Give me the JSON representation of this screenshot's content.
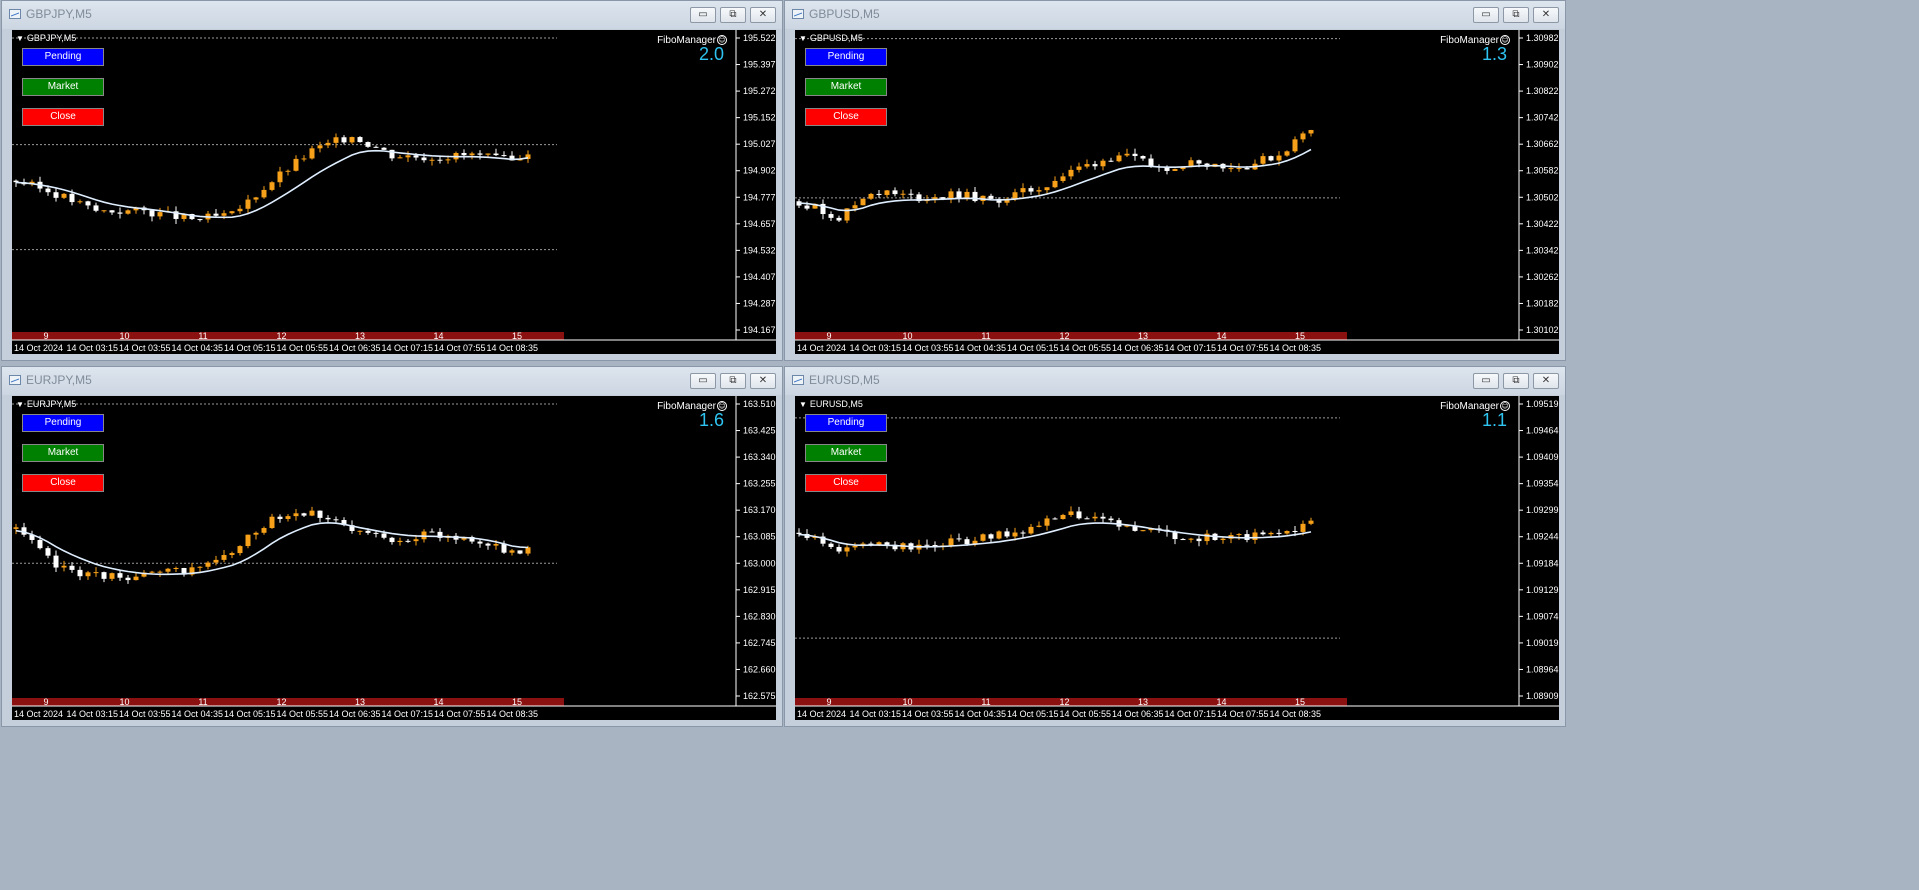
{
  "colors": {
    "bull": "#f7a11a",
    "bear": "#ffffff",
    "ma": "#dfeeff",
    "level": "#9a9a9a",
    "axis": "#ffffff",
    "day_bar": "#8b1010",
    "value": "#2ec3f0"
  },
  "icons": [
    "chart-window-icon",
    "minimize-icon",
    "maximize-icon",
    "close-icon",
    "smile-icon",
    "triangle-down-icon"
  ],
  "windows": [
    {
      "title": "GBPJPY,M5",
      "symbol": "GBPJPY,M5",
      "fibo": "FiboManager",
      "value": "2.0",
      "buttons": {
        "pending": "Pending",
        "market": "Market",
        "close": "Close"
      },
      "controls": {
        "min": "▭",
        "max": "⧉",
        "close": "✕"
      }
    },
    {
      "title": "GBPUSD,M5",
      "symbol": "GBPUSD,M5",
      "fibo": "FiboManager",
      "value": "1.3",
      "buttons": {
        "pending": "Pending",
        "market": "Market",
        "close": "Close"
      },
      "controls": {
        "min": "▭",
        "max": "⧉",
        "close": "✕"
      }
    },
    {
      "title": "EURJPY,M5",
      "symbol": "EURJPY,M5",
      "fibo": "FiboManager",
      "value": "1.6",
      "buttons": {
        "pending": "Pending",
        "market": "Market",
        "close": "Close"
      },
      "controls": {
        "min": "▭",
        "max": "⧉",
        "close": "✕"
      }
    },
    {
      "title": "EURUSD,M5",
      "symbol": "EURUSD,M5",
      "fibo": "FiboManager",
      "value": "1.1",
      "buttons": {
        "pending": "Pending",
        "market": "Market",
        "close": "Close"
      },
      "controls": {
        "min": "▭",
        "max": "⧉",
        "close": "✕"
      }
    }
  ],
  "chart_data": [
    {
      "type": "candlestick",
      "symbol": "GBPJPY,M5",
      "y_ticks": [
        "195.522",
        "195.397",
        "195.272",
        "195.152",
        "195.027",
        "194.902",
        "194.777",
        "194.657",
        "194.532",
        "194.407",
        "194.287",
        "194.167"
      ],
      "ylim": [
        194.167,
        195.522
      ],
      "x_labels": [
        "14 Oct 2024",
        "14 Oct 03:15",
        "14 Oct 03:55",
        "14 Oct 04:35",
        "14 Oct 05:15",
        "14 Oct 05:55",
        "14 Oct 06:35",
        "14 Oct 07:15",
        "14 Oct 07:55",
        "14 Oct 08:35"
      ],
      "day_labels": [
        "9",
        "10",
        "11",
        "12",
        "13",
        "14",
        "15"
      ],
      "levels": [
        195.522,
        195.027,
        194.54
      ],
      "anchors": [
        [
          0,
          194.86
        ],
        [
          5,
          194.8
        ],
        [
          10,
          194.72
        ],
        [
          16,
          194.72
        ],
        [
          22,
          194.68
        ],
        [
          27,
          194.7
        ],
        [
          32,
          194.86
        ],
        [
          37,
          195.0
        ],
        [
          42,
          195.07
        ],
        [
          47,
          194.98
        ],
        [
          52,
          194.97
        ],
        [
          57,
          194.98
        ],
        [
          62,
          194.95
        ],
        [
          64,
          195.0
        ]
      ]
    },
    {
      "type": "candlestick",
      "symbol": "GBPUSD,M5",
      "y_ticks": [
        "1.30982",
        "1.30902",
        "1.30822",
        "1.30742",
        "1.30662",
        "1.30582",
        "1.30502",
        "1.30422",
        "1.30342",
        "1.30262",
        "1.30182",
        "1.30102"
      ],
      "ylim": [
        1.30102,
        1.30982
      ],
      "x_labels": [
        "14 Oct 2024",
        "14 Oct 03:15",
        "14 Oct 03:55",
        "14 Oct 04:35",
        "14 Oct 05:15",
        "14 Oct 05:55",
        "14 Oct 06:35",
        "14 Oct 07:15",
        "14 Oct 07:55",
        "14 Oct 08:35"
      ],
      "day_labels": [
        "9",
        "10",
        "11",
        "12",
        "13",
        "14",
        "15"
      ],
      "levels": [
        1.3098,
        1.305
      ],
      "anchors": [
        [
          0,
          1.3049
        ],
        [
          5,
          1.3044
        ],
        [
          9,
          1.3052
        ],
        [
          15,
          1.305
        ],
        [
          20,
          1.3051
        ],
        [
          24,
          1.3049
        ],
        [
          30,
          1.3053
        ],
        [
          35,
          1.3059
        ],
        [
          40,
          1.3063
        ],
        [
          45,
          1.3059
        ],
        [
          50,
          1.3061
        ],
        [
          55,
          1.3059
        ],
        [
          60,
          1.3063
        ],
        [
          64,
          1.3071
        ]
      ]
    },
    {
      "type": "candlestick",
      "symbol": "EURJPY,M5",
      "y_ticks": [
        "163.510",
        "163.425",
        "163.340",
        "163.255",
        "163.170",
        "163.085",
        "163.000",
        "162.915",
        "162.830",
        "162.745",
        "162.660",
        "162.575"
      ],
      "ylim": [
        162.575,
        163.51
      ],
      "x_labels": [
        "14 Oct 2024",
        "14 Oct 03:15",
        "14 Oct 03:55",
        "14 Oct 04:35",
        "14 Oct 05:15",
        "14 Oct 05:55",
        "14 Oct 06:35",
        "14 Oct 07:15",
        "14 Oct 07:55",
        "14 Oct 08:35"
      ],
      "day_labels": [
        "9",
        "10",
        "11",
        "12",
        "13",
        "14",
        "15"
      ],
      "levels": [
        163.51,
        163.0
      ],
      "anchors": [
        [
          0,
          163.11
        ],
        [
          5,
          162.99
        ],
        [
          10,
          162.96
        ],
        [
          16,
          162.96
        ],
        [
          22,
          162.98
        ],
        [
          27,
          163.03
        ],
        [
          32,
          163.15
        ],
        [
          37,
          163.17
        ],
        [
          42,
          163.1
        ],
        [
          47,
          163.08
        ],
        [
          52,
          163.09
        ],
        [
          57,
          163.08
        ],
        [
          62,
          163.03
        ],
        [
          64,
          163.05
        ]
      ]
    },
    {
      "type": "candlestick",
      "symbol": "EURUSD,M5",
      "y_ticks": [
        "1.09519",
        "1.09464",
        "1.09409",
        "1.09354",
        "1.09299",
        "1.09244",
        "1.09184",
        "1.09129",
        "1.09074",
        "1.09019",
        "1.08964",
        "1.08909"
      ],
      "ylim": [
        1.08909,
        1.09519
      ],
      "x_labels": [
        "14 Oct 2024",
        "14 Oct 03:15",
        "14 Oct 03:55",
        "14 Oct 04:35",
        "14 Oct 05:15",
        "14 Oct 05:55",
        "14 Oct 06:35",
        "14 Oct 07:15",
        "14 Oct 07:55",
        "14 Oct 08:35"
      ],
      "day_labels": [
        "9",
        "10",
        "11",
        "12",
        "13",
        "14",
        "15"
      ],
      "levels": [
        1.0949,
        1.0903
      ],
      "anchors": [
        [
          0,
          1.0925
        ],
        [
          5,
          1.0921
        ],
        [
          9,
          1.0923
        ],
        [
          14,
          1.0922
        ],
        [
          19,
          1.0923
        ],
        [
          24,
          1.0924
        ],
        [
          29,
          1.0926
        ],
        [
          34,
          1.0929
        ],
        [
          39,
          1.0927
        ],
        [
          44,
          1.0925
        ],
        [
          50,
          1.0924
        ],
        [
          55,
          1.0924
        ],
        [
          60,
          1.0925
        ],
        [
          64,
          1.0927
        ]
      ]
    }
  ]
}
